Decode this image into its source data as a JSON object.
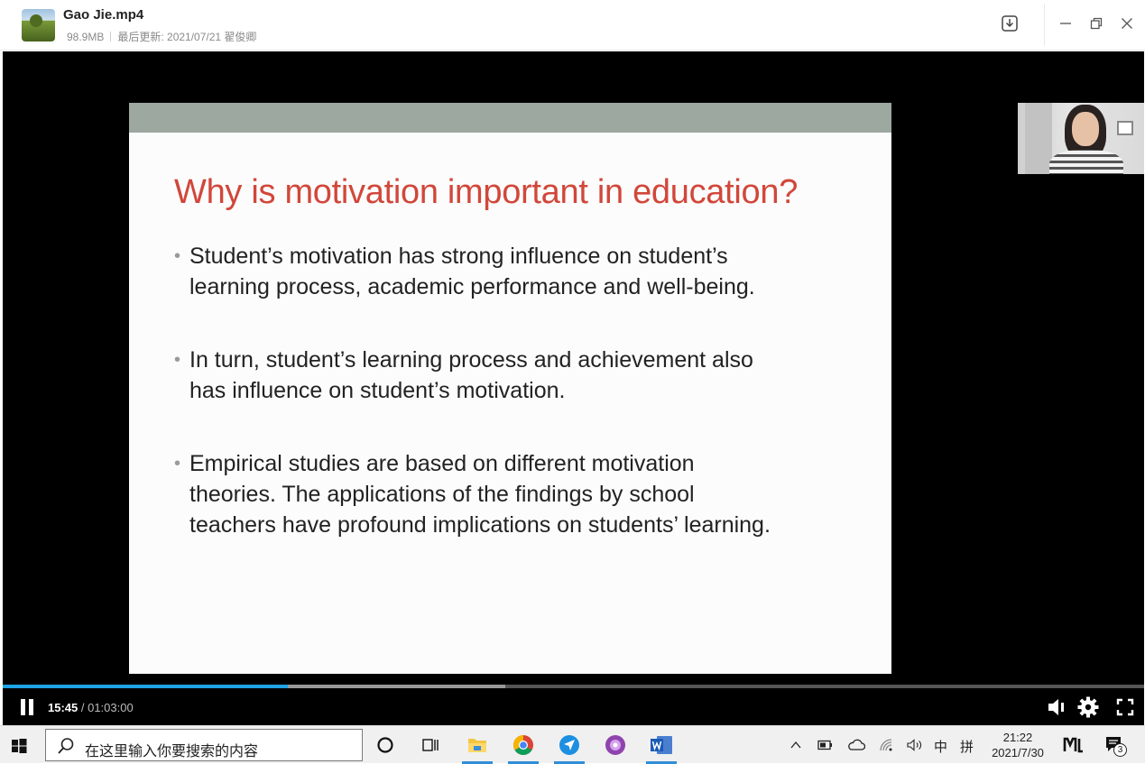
{
  "window": {
    "file_name": "Gao Jie.mp4",
    "file_size": "98.9MB",
    "updated": "最后更新: 2021/07/21 翟俊卿"
  },
  "slide": {
    "title": "Why is motivation important in education?",
    "bullets": [
      [
        "Student’s motivation has strong influence on student’s",
        "learning process,  academic performance and well-being."
      ],
      [
        "In turn, student’s learning process and achievement also",
        "has influence on student’s motivation."
      ],
      [
        "Empirical studies are based on different motivation",
        "theories. The applications of the findings by school",
        "teachers have profound implications on students’ learning."
      ]
    ],
    "bullet_char": "•"
  },
  "player": {
    "current_time": "15:45",
    "separator": " / ",
    "duration": "01:03:00",
    "progress_fraction": 0.25,
    "buffered_fraction": 0.44,
    "accent_color": "#1ea3e6"
  },
  "taskbar": {
    "search_placeholder": "在这里输入你要搜索的内容",
    "ime_mode": "中",
    "ime_name": "拼",
    "time": "21:22",
    "date": "2021/7/30",
    "notification_count": "3"
  },
  "icons": [
    "download-icon",
    "minimize-icon",
    "restore-icon",
    "close-icon",
    "pause-icon",
    "volume-icon",
    "settings-icon",
    "fullscreen-icon",
    "windows-start-icon",
    "search-icon",
    "cortana-icon",
    "task-view-icon",
    "file-explorer-icon",
    "chrome-icon",
    "feishu-icon",
    "app-icon",
    "word-icon",
    "tray-up-icon",
    "battery-icon",
    "onedrive-icon",
    "wifi-icon",
    "speaker-icon",
    "notification-icon"
  ]
}
